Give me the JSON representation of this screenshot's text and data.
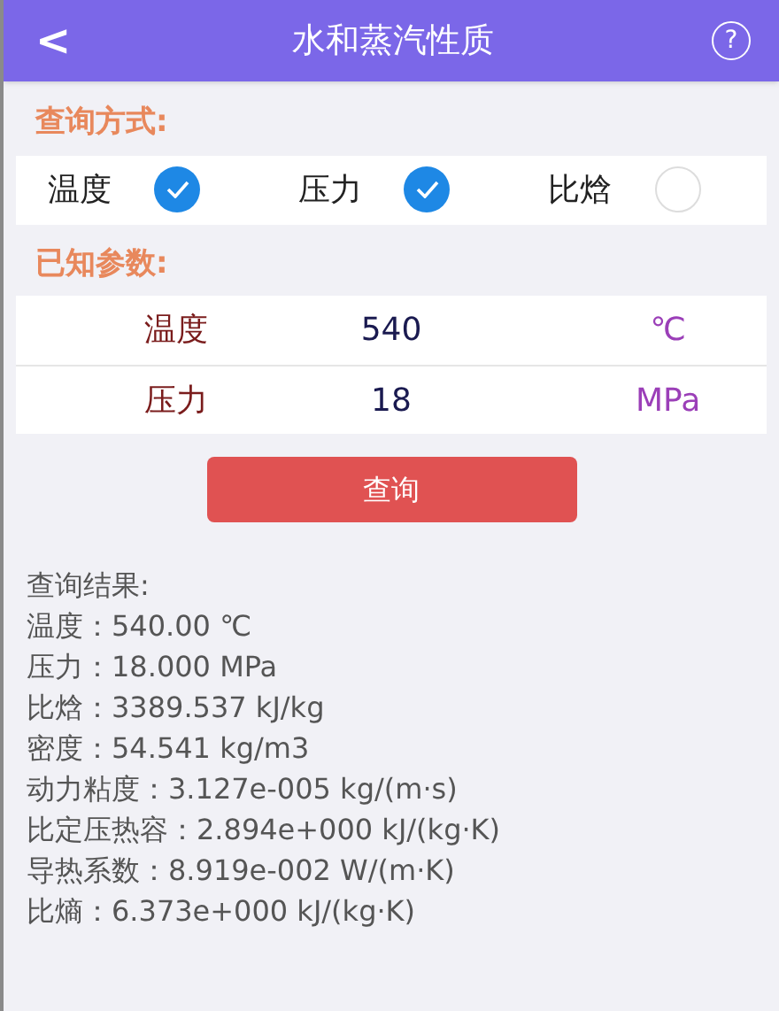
{
  "header": {
    "back": "<",
    "title": "水和蒸汽性质",
    "help": "?"
  },
  "query_mode": {
    "label": "查询方式:",
    "options": [
      {
        "label": "温度",
        "checked": true
      },
      {
        "label": "压力",
        "checked": true
      },
      {
        "label": "比焓",
        "checked": false
      }
    ]
  },
  "params": {
    "label": "已知参数:",
    "rows": [
      {
        "name": "温度",
        "value": "540",
        "unit": "℃"
      },
      {
        "name": "压力",
        "value": "18",
        "unit": "MPa"
      }
    ]
  },
  "button": "查询",
  "results": [
    "查询结果:",
    "温度：540.00 ℃",
    "压力：18.000 MPa",
    "比焓：3389.537 kJ/kg",
    "密度：54.541 kg/m3",
    "动力粘度：3.127e-005 kg/(m·s)",
    "比定压热容：2.894e+000 kJ/(kg·K)",
    "导热系数：8.919e-002 W/(m·K)",
    "比熵：6.373e+000 kJ/(kg·K)"
  ]
}
